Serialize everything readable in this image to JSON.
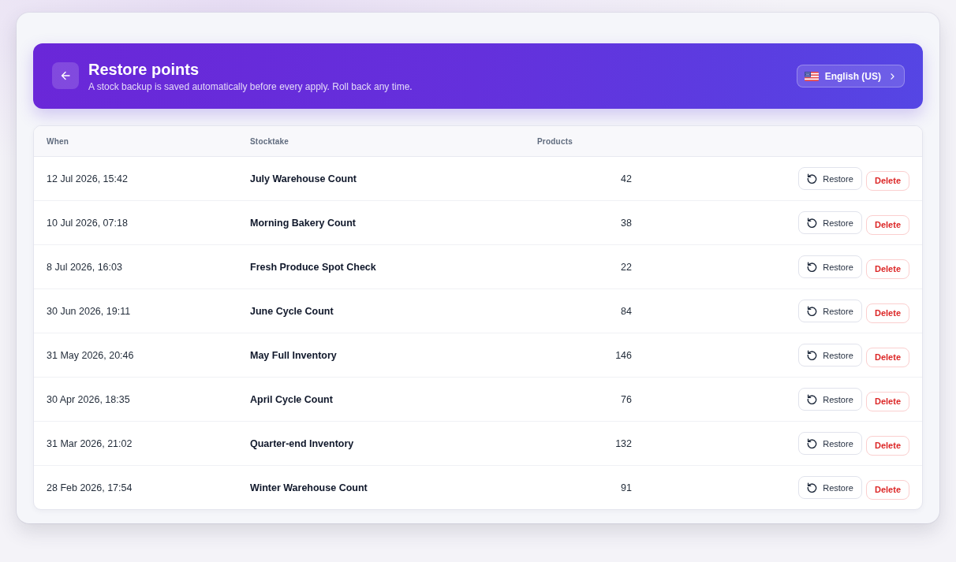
{
  "header": {
    "title": "Restore points",
    "subtitle": "A stock backup is saved automatically before every apply. Roll back any time.",
    "language": {
      "label": "English (US)"
    }
  },
  "table": {
    "columns": [
      "When",
      "Stocktake",
      "Products"
    ],
    "rows": [
      {
        "when": "12 Jul 2026, 15:42",
        "stocktake": "July Warehouse Count",
        "products": "42",
        "actions": [
          {
            "kind": "restore",
            "label": "Restore"
          },
          {
            "kind": "delete",
            "label": "Delete"
          }
        ]
      },
      {
        "when": "10 Jul 2026, 07:18",
        "stocktake": "Morning Bakery Count",
        "products": "38",
        "actions": [
          {
            "kind": "restore",
            "label": "Restore"
          },
          {
            "kind": "delete",
            "label": "Delete"
          }
        ]
      },
      {
        "when": "8 Jul 2026, 16:03",
        "stocktake": "Fresh Produce Spot Check",
        "products": "22",
        "actions": [
          {
            "kind": "restore",
            "label": "Restore"
          },
          {
            "kind": "delete",
            "label": "Delete"
          }
        ]
      },
      {
        "when": "30 Jun 2026, 19:11",
        "stocktake": "June Cycle Count",
        "products": "84",
        "actions": [
          {
            "kind": "restore",
            "label": "Restore"
          },
          {
            "kind": "delete",
            "label": "Delete"
          }
        ]
      },
      {
        "when": "31 May 2026, 20:46",
        "stocktake": "May Full Inventory",
        "products": "146",
        "actions": [
          {
            "kind": "restore",
            "label": "Restore"
          },
          {
            "kind": "delete",
            "label": "Delete"
          }
        ]
      },
      {
        "when": "30 Apr 2026, 18:35",
        "stocktake": "April Cycle Count",
        "products": "76",
        "actions": [
          {
            "kind": "restore",
            "label": "Restore"
          },
          {
            "kind": "delete",
            "label": "Delete"
          }
        ]
      },
      {
        "when": "31 Mar 2026, 21:02",
        "stocktake": "Quarter-end Inventory",
        "products": "132",
        "actions": [
          {
            "kind": "restore",
            "label": "Restore"
          },
          {
            "kind": "delete",
            "label": "Delete"
          }
        ]
      },
      {
        "when": "28 Feb 2026, 17:54",
        "stocktake": "Winter Warehouse Count",
        "products": "91",
        "actions": [
          {
            "kind": "restore",
            "label": "Restore"
          },
          {
            "kind": "delete",
            "label": "Delete"
          }
        ]
      }
    ]
  }
}
